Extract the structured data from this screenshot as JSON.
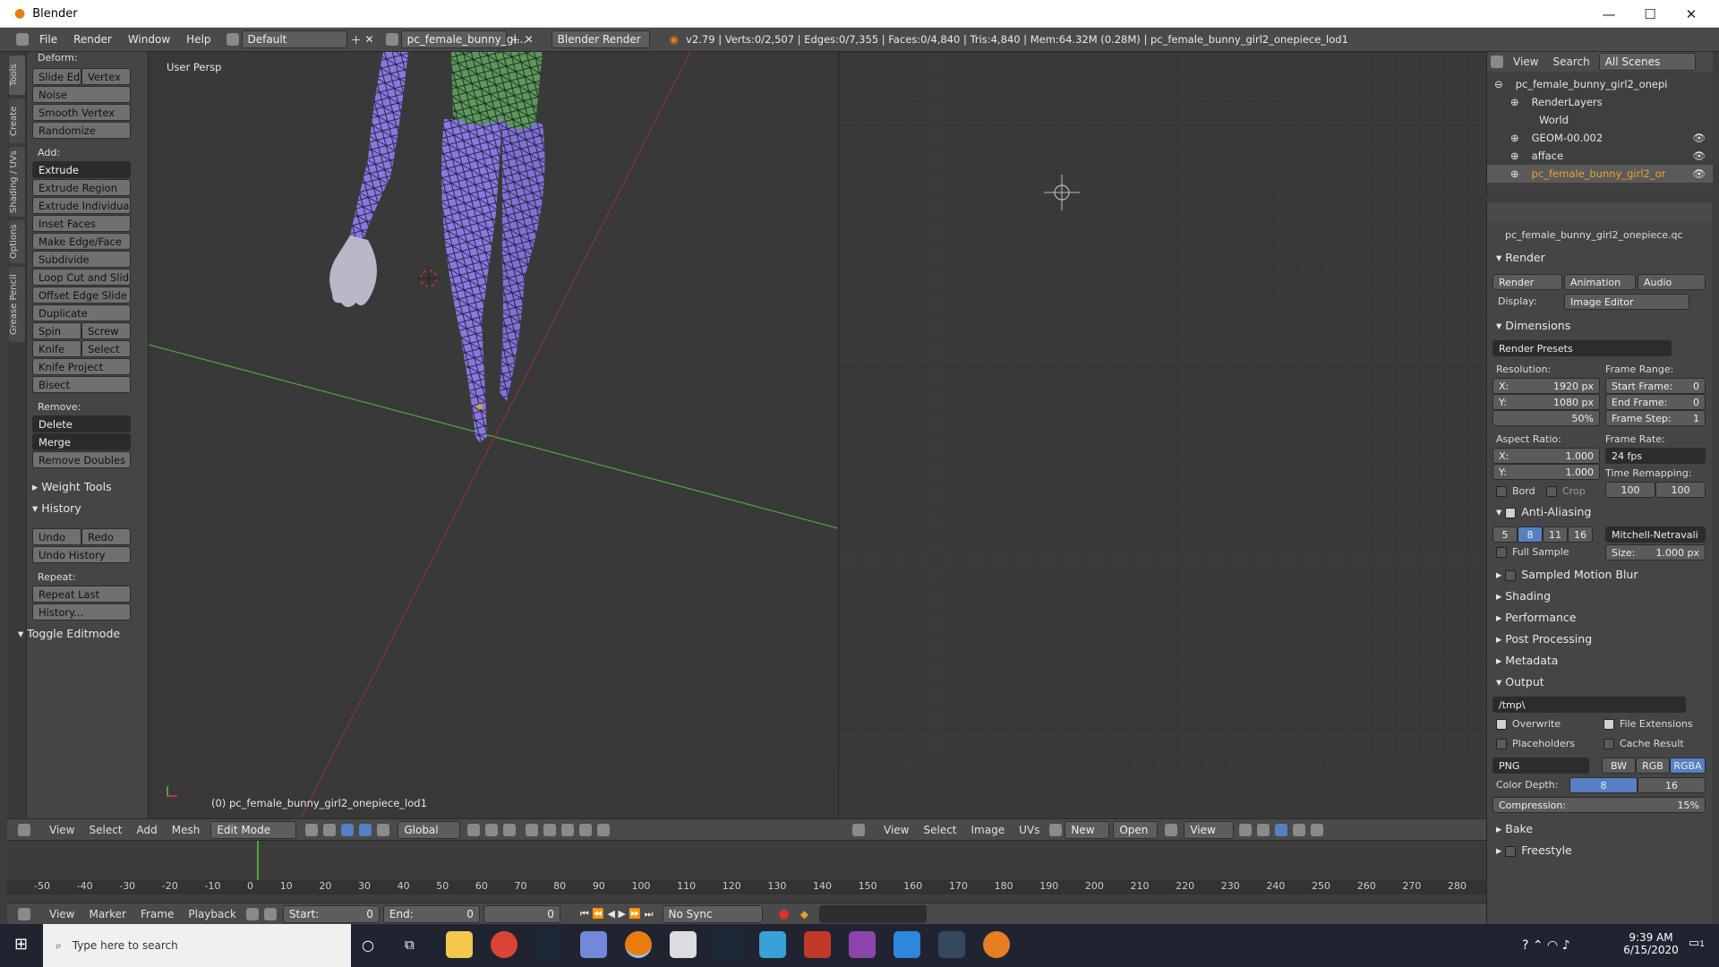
{
  "window": {
    "title": "Blender",
    "min": "—",
    "max": "☐",
    "close": "✕"
  },
  "menu": {
    "items": [
      "File",
      "Render",
      "Window",
      "Help"
    ],
    "layout": "Default",
    "scene": "pc_female_bunny_gi...",
    "engine": "Blender Render",
    "stats": "v2.79 | Verts:0/2,507 | Edges:0/7,355 | Faces:0/4,840 | Tris:4,840 | Mem:64.32M (0.28M) | pc_female_bunny_girl2_onepiece_lod1"
  },
  "tabs": [
    "Tools",
    "Create",
    "Shading / UVs",
    "Options",
    "Grease Pencil"
  ],
  "shelf": {
    "deform": "Deform:",
    "slide_edge": "Slide Ed",
    "vertex": "Vertex",
    "noise": "Noise",
    "smooth": "Smooth Vertex",
    "randomize": "Randomize",
    "add": "Add:",
    "extrude": "Extrude",
    "extrude_region": "Extrude Region",
    "extrude_individual": "Extrude Individual",
    "inset": "Inset Faces",
    "make_edge": "Make Edge/Face",
    "subdivide": "Subdivide",
    "loop_cut": "Loop Cut and Slide",
    "offset_edge": "Offset Edge Slide",
    "duplicate": "Duplicate",
    "spin": "Spin",
    "screw": "Screw",
    "knife": "Knife",
    "select": "Select",
    "knife_project": "Knife Project",
    "bisect": "Bisect",
    "remove": "Remove:",
    "delete": "Delete",
    "merge": "Merge",
    "remove_doubles": "Remove Doubles",
    "weight_tools": "Weight Tools",
    "history": "History",
    "undo": "Undo",
    "redo": "Redo",
    "undo_history": "Undo History",
    "repeat": "Repeat:",
    "repeat_last": "Repeat Last",
    "history_btn": "History...",
    "toggle_editmode": "Toggle Editmode"
  },
  "viewport": {
    "label": "User Persp",
    "object": "(0) pc_female_bunny_girl2_onepiece_lod1",
    "footer": [
      "View",
      "Select",
      "Add",
      "Mesh"
    ],
    "mode": "Edit Mode",
    "orientation": "Global"
  },
  "image_editor": {
    "footer": [
      "View",
      "Select",
      "Image",
      "UVs"
    ],
    "new": "New",
    "open": "Open",
    "view": "View"
  },
  "timeline": {
    "ticks": [
      "-50",
      "-40",
      "-30",
      "-20",
      "-10",
      "0",
      "10",
      "20",
      "30",
      "40",
      "50",
      "60",
      "70",
      "80",
      "90",
      "100",
      "110",
      "120",
      "130",
      "140",
      "150",
      "160",
      "170",
      "180",
      "190",
      "200",
      "210",
      "220",
      "230",
      "240",
      "250",
      "260",
      "270",
      "280"
    ],
    "footer": [
      "View",
      "Marker",
      "Frame",
      "Playback"
    ],
    "start": "Start:",
    "start_v": "0",
    "end": "End:",
    "end_v": "0",
    "current": "0",
    "sync": "No Sync"
  },
  "outliner": {
    "view": "View",
    "search": "Search",
    "scenes": "All Scenes",
    "rows": [
      "pc_female_bunny_girl2_onepi",
      "RenderLayers",
      "World",
      "GEOM-00.002",
      "afface",
      "pc_female_bunny_girl2_or"
    ]
  },
  "props": {
    "object": "pc_female_bunny_girl2_onepiece.qc",
    "render": "Render",
    "render_btn": "Render",
    "animation": "Animation",
    "audio": "Audio",
    "display": "Display:",
    "display_v": "Image Editor",
    "dimensions": "Dimensions",
    "presets": "Render Presets",
    "resolution": "Resolution:",
    "res_x": "X:",
    "res_x_v": "1920 px",
    "res_y": "Y:",
    "res_y_v": "1080 px",
    "res_pct": "50%",
    "frame_range": "Frame Range:",
    "start_frame": "Start Frame:",
    "start_frame_v": "0",
    "end_frame": "End Frame:",
    "end_frame_v": "0",
    "frame_step": "Frame Step:",
    "frame_step_v": "1",
    "aspect": "Aspect Ratio:",
    "asp_x": "X:",
    "asp_x_v": "1.000",
    "asp_y": "Y:",
    "asp_y_v": "1.000",
    "frame_rate": "Frame Rate:",
    "fps": "24 fps",
    "bord": "Bord",
    "crop": "Crop",
    "time_remap": "Time Remapping:",
    "remap_a": "100",
    "remap_b": "100",
    "aa": "Anti-Aliasing",
    "aa_vals": [
      "5",
      "8",
      "11",
      "16"
    ],
    "filter": "Mitchell-Netravali",
    "full_sample": "Full Sample",
    "size": "Size:",
    "size_v": "1.000 px",
    "motion_blur": "Sampled Motion Blur",
    "shading": "Shading",
    "performance": "Performance",
    "post": "Post Processing",
    "metadata": "Metadata",
    "output": "Output",
    "path": "/tmp\\",
    "overwrite": "Overwrite",
    "file_ext": "File Extensions",
    "placeholders": "Placeholders",
    "cache": "Cache Result",
    "format": "PNG",
    "bw": "BW",
    "rgb": "RGB",
    "rgba": "RGBA",
    "color_depth": "Color Depth:",
    "depth_8": "8",
    "depth_16": "16",
    "compression": "Compression:",
    "compression_v": "15%",
    "bake": "Bake",
    "freestyle": "Freestyle"
  },
  "taskbar": {
    "search": "Type here to search",
    "time": "9:39 AM",
    "date": "6/15/2020",
    "notif": "1"
  },
  "colors": {
    "accent": "#5680c2",
    "mesh": "#8878e0",
    "green_mesh": "#5a9a55",
    "axis_red": "#b33b3b",
    "axis_green": "#4aa63a"
  }
}
